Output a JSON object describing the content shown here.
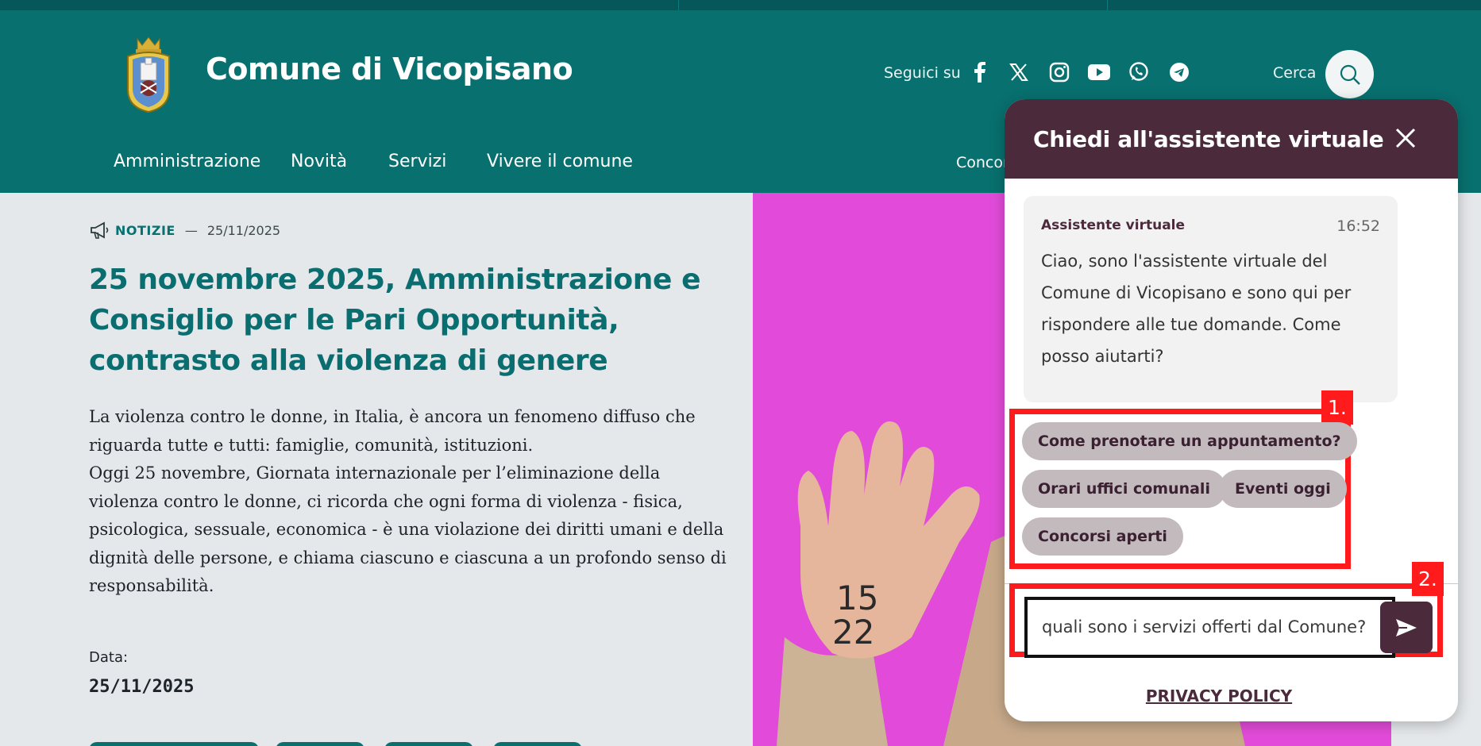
{
  "header": {
    "site_title": "Comune di Vicopisano",
    "social_label": "Seguici su",
    "social_icons": [
      "facebook-icon",
      "x-icon",
      "instagram-icon",
      "youtube-icon",
      "whatsapp-icon",
      "telegram-icon"
    ],
    "search_label": "Cerca",
    "nav": [
      "Amministrazione",
      "Novità",
      "Servizi",
      "Vivere il comune"
    ],
    "nav_right": "Concors"
  },
  "article": {
    "category": "NOTIZIE",
    "separator": "—",
    "date_meta": "25/11/2025",
    "headline": "25 novembre 2025, Amministrazione e Consiglio per le Pari Opportunità, contrasto alla violenza di genere",
    "paragraph1": "La violenza contro le donne, in Italia, è ancora un fenomeno diffuso che riguarda tutte e tutti: famiglie, comunità, istituzioni.",
    "paragraph2": "Oggi 25 novembre, Giornata internazionale per l’eliminazione della violenza contro le donne, ci ricorda che ogni forma di violenza - fisica, psicologica, sessuale, economica - è una violazione dei diritti umani e della dignità delle persone, e chiama ciascuno e ciascuna a un profondo senso di responsabilità.",
    "date_label": "Data:",
    "date_value": "25/11/2025"
  },
  "hero": {
    "hand_text_line1": "15",
    "hand_text_line2": "22"
  },
  "chat": {
    "title": "Chiedi all'assistente virtuale",
    "message_author": "Assistente virtuale",
    "message_time": "16:52",
    "message_text": "Ciao, sono l'assistente virtuale del Comune di Vicopisano e sono qui per rispondere alle tue domande. Come posso aiutarti?",
    "badge1": "1.",
    "badge2": "2.",
    "suggestions": [
      "Come prenotare un appuntamento?",
      "Orari uffici comunali",
      "Eventi oggi",
      "Concorsi aperti"
    ],
    "input_value": "quali sono i servizi offerti dal Comune?",
    "privacy_link": "PRIVACY POLICY"
  },
  "colors": {
    "header_teal": "#08706f",
    "chat_plum": "#4b2a3c",
    "highlight_red": "#ff1b1b",
    "hero_magenta": "#e24bd9"
  }
}
